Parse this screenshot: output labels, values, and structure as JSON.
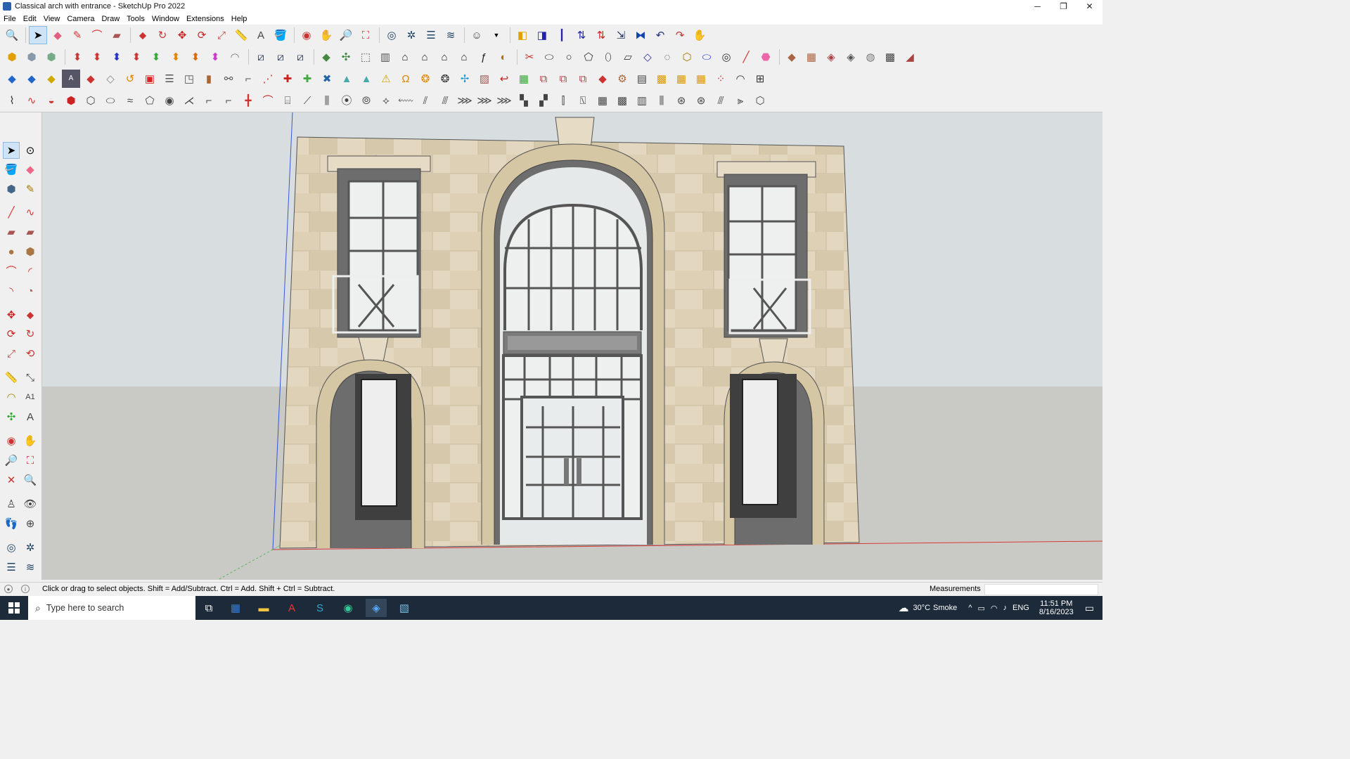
{
  "window": {
    "title": "Classical arch with entrance - SketchUp Pro 2022",
    "minimize": "─",
    "restore": "❐",
    "close": "✕"
  },
  "menu": [
    "File",
    "Edit",
    "View",
    "Camera",
    "Draw",
    "Tools",
    "Window",
    "Extensions",
    "Help"
  ],
  "status": {
    "hint": "Click or drag to select objects. Shift = Add/Subtract. Ctrl = Add. Shift + Ctrl = Subtract.",
    "measurements_label": "Measurements",
    "measurements_value": ""
  },
  "taskbar": {
    "search_placeholder": "Type here to search",
    "weather_temp": "30°C",
    "weather_desc": "Smoke",
    "language": "ENG",
    "time": "11:51 PM",
    "date": "8/16/2023"
  },
  "colors": {
    "sky": "#d8dde0",
    "ground": "#c9c9c5",
    "stone": "#e3d7bf",
    "frame": "#6d6d6d",
    "glass": "#eef0f0",
    "red_axis": "#d83a3a",
    "blue_axis": "#3a55d8",
    "green_axis": "#5cb85c",
    "taskbar": "#1c2a3a"
  }
}
